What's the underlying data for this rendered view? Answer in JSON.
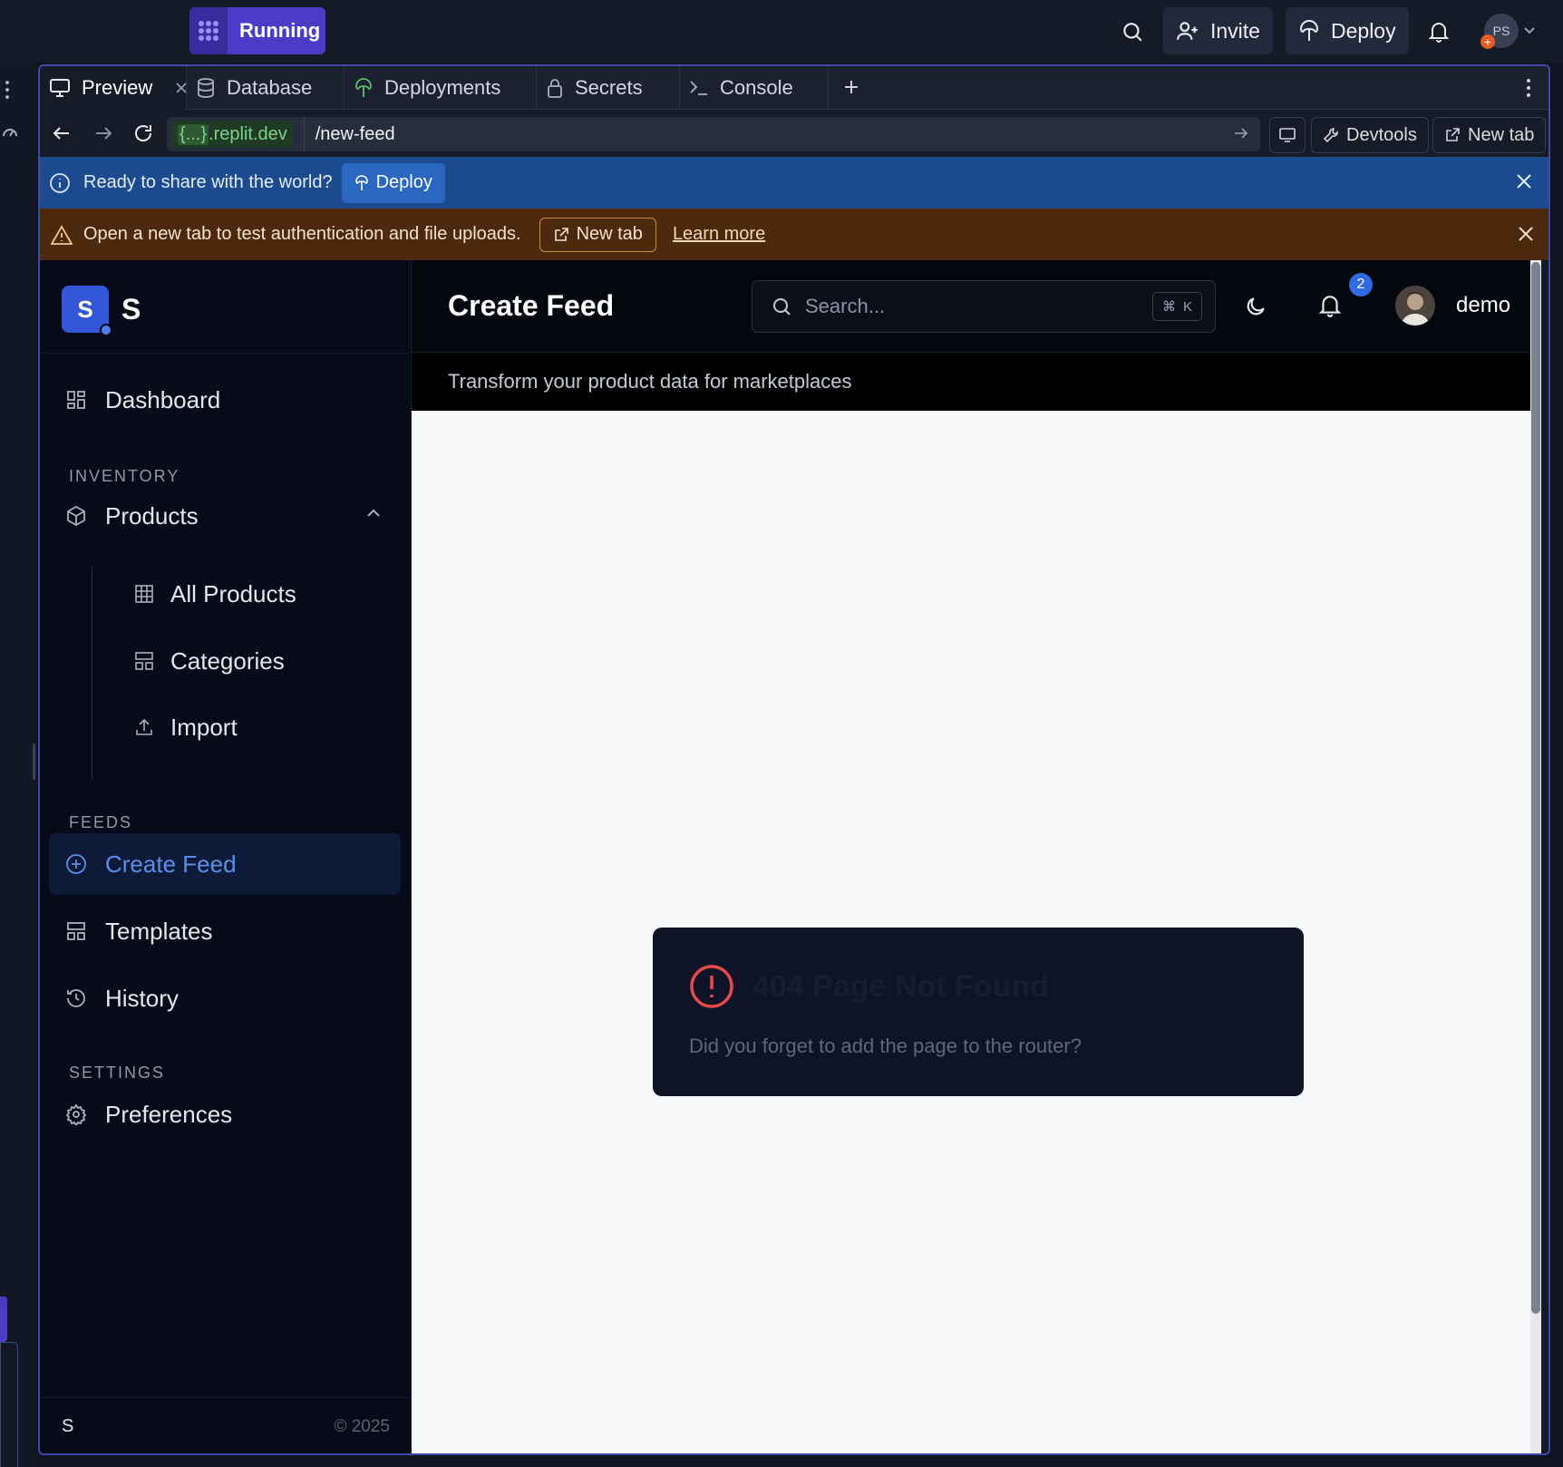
{
  "topbar": {
    "status": "Running",
    "invite_label": "Invite",
    "deploy_label": "Deploy",
    "avatar_initials": "PS"
  },
  "tabs": [
    {
      "label": "Preview",
      "icon": "monitor-icon"
    },
    {
      "label": "Database",
      "icon": "database-icon"
    },
    {
      "label": "Deployments",
      "icon": "deploy-icon"
    },
    {
      "label": "Secrets",
      "icon": "lock-icon"
    },
    {
      "label": "Console",
      "icon": "terminal-icon"
    }
  ],
  "urlbar": {
    "host_badge": "{...}",
    "host": ".replit.dev",
    "path": "/new-feed",
    "devtools_label": "Devtools",
    "newtab_label": "New tab"
  },
  "banners": {
    "share_text": "Ready to share with the world?",
    "share_deploy": "Deploy",
    "warning_text": "Open a new tab to test authentication and file uploads.",
    "warning_newtab": "New tab",
    "warning_learn": "Learn more"
  },
  "sidebar": {
    "brand_badge": "S",
    "brand_name": "S",
    "dashboard": "Dashboard",
    "section_inventory": "INVENTORY",
    "products": "Products",
    "all_products": "All Products",
    "categories": "Categories",
    "import": "Import",
    "section_feeds": "FEEDS",
    "create_feed": "Create Feed",
    "templates": "Templates",
    "history": "History",
    "section_settings": "SETTINGS",
    "preferences": "Preferences",
    "footer_name": "S",
    "footer_copy": "© 2025"
  },
  "main": {
    "title": "Create Feed",
    "search_placeholder": "Search...",
    "kbd_cmd": "⌘",
    "kbd_key": "K",
    "notif_count": "2",
    "user_name": "demo",
    "subtitle": "Transform your product data for marketplaces",
    "error_title": "404 Page Not Found",
    "error_message": "Did you forget to add the page to the router?"
  },
  "colors": {
    "accent": "#4b3bc6",
    "share_banner": "#1c4b8f",
    "warning_banner": "#4d2a0e",
    "active_nav": "#5b8fea",
    "error": "#e5484d"
  }
}
